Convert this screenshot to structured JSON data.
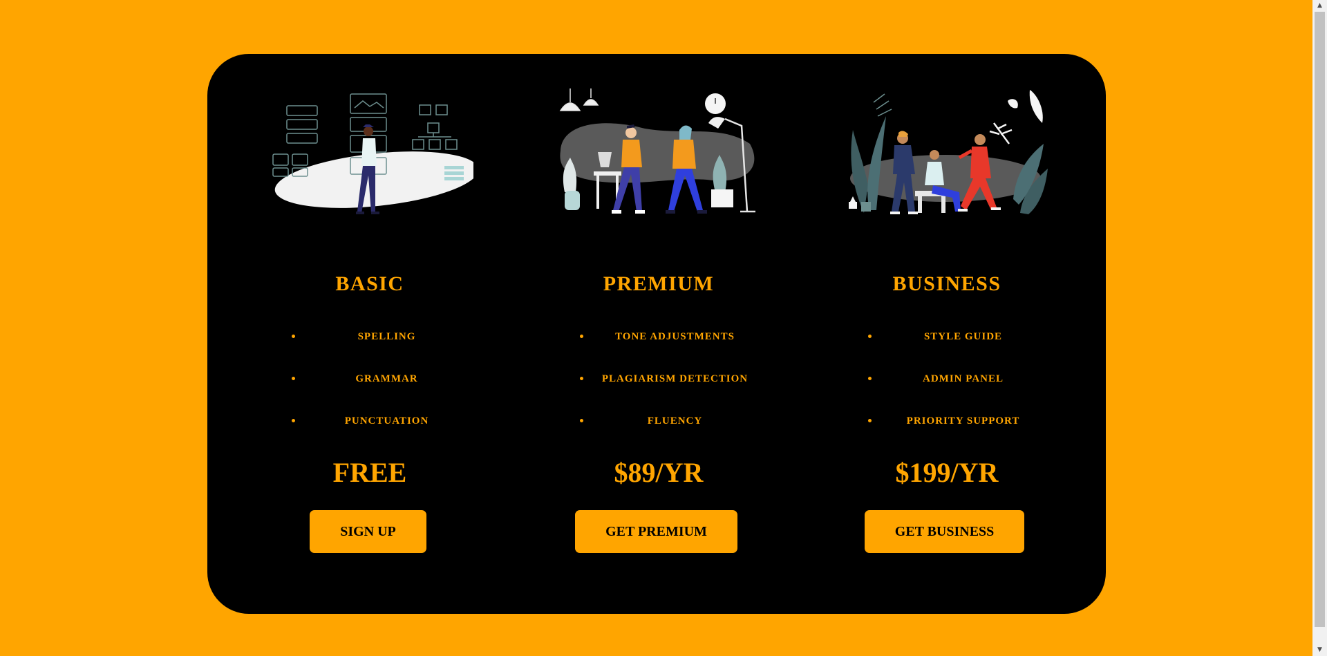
{
  "plans": [
    {
      "title": "BASIC",
      "features": [
        "SPELLING",
        "GRAMMAR",
        "PUNCTUATION"
      ],
      "price": "FREE",
      "cta": "SIGN UP",
      "illustration": "person-at-board-illustration"
    },
    {
      "title": "PREMIUM",
      "features": [
        "TONE ADJUSTMENTS",
        "PLAGIARISM DETECTION",
        "FLUENCY"
      ],
      "price": "$89/YR",
      "cta": "GET PREMIUM",
      "illustration": "two-people-walking-illustration"
    },
    {
      "title": "BUSINESS",
      "features": [
        "STYLE GUIDE",
        "ADMIN PANEL",
        "PRIORITY SUPPORT"
      ],
      "price": "$199/YR",
      "cta": "GET BUSINESS",
      "illustration": "team-meeting-illustration"
    }
  ],
  "colors": {
    "background": "#FFA500",
    "card": "#000000",
    "accent": "#FFA500",
    "button_text": "#000000"
  }
}
